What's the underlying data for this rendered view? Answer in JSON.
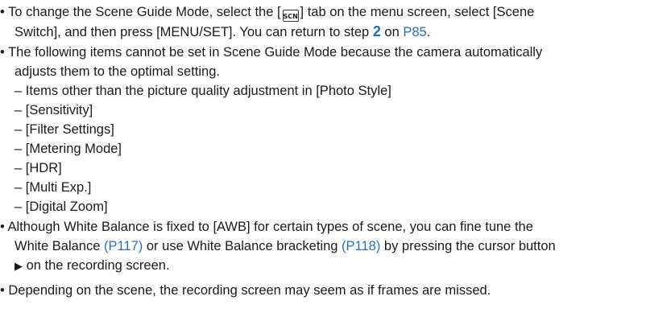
{
  "bullet": "•",
  "dash": "–",
  "p1": {
    "a": "To change the Scene Guide Mode, select the [",
    "icon_name": "scn-tab-icon",
    "icon_text": "SCN",
    "b": "] tab on the menu screen, select [Scene",
    "c": "Switch], and then press [MENU/SET]. You can return to step ",
    "step": "2",
    "d": " on ",
    "link": "P85",
    "e": "."
  },
  "p2": {
    "l1": "The following items cannot be set in Scene Guide Mode because the camera automatically",
    "l2": "adjusts them to the optimal setting.",
    "items": [
      "Items other than the picture quality adjustment in [Photo Style]",
      "[Sensitivity]",
      "[Filter Settings]",
      "[Metering Mode]",
      "[HDR]",
      "[Multi Exp.]",
      "[Digital Zoom]"
    ]
  },
  "p3": {
    "l1": "Although White Balance is fixed to [AWB] for certain types of scene, you can fine tune the",
    "l2a": "White Balance ",
    "link1": "(P117)",
    "l2b": " or use White Balance bracketing ",
    "link2": "(P118)",
    "l2c": " by pressing the cursor button",
    "arrow_icon": "right-triangle-icon",
    "l3": " on the recording screen."
  },
  "p4": {
    "l1": "Depending on the scene, the recording screen may seem as if frames are missed."
  }
}
